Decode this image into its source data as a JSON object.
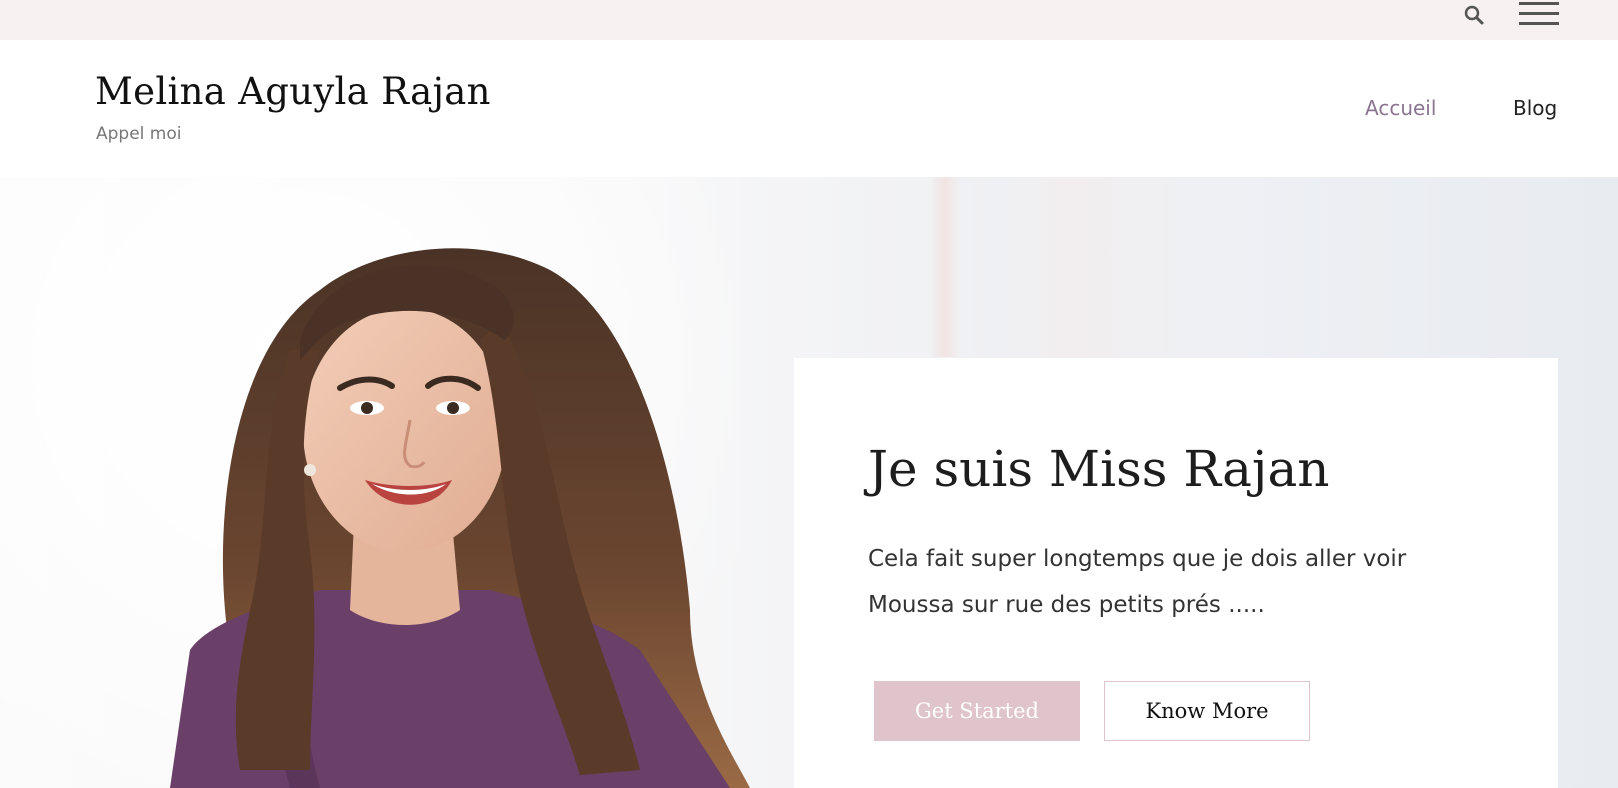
{
  "topbar": {
    "search_icon": "search-icon",
    "menu_icon": "hamburger-menu-icon"
  },
  "header": {
    "site_title": "Melina Aguyla Rajan",
    "tagline": "Appel moi",
    "nav": [
      {
        "label": "Accueil",
        "color": "#8a7591"
      },
      {
        "label": "Blog",
        "color": "#222222"
      }
    ]
  },
  "hero": {
    "title": "Je suis Miss Rajan",
    "text": "Cela fait super longtemps que je dois aller voir Moussa sur rue des petits prés .....",
    "primary_button": "Get Started",
    "secondary_button": "Know More",
    "accent_color": "#dfc4cb"
  }
}
